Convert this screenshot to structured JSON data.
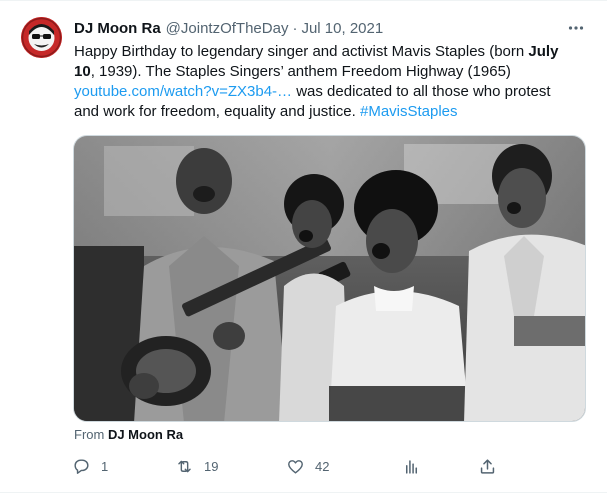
{
  "author": {
    "name": "DJ Moon Ra",
    "handle": "@JointzOfTheDay",
    "separator": "·",
    "date": "Jul 10, 2021"
  },
  "tweet": {
    "line1": "Happy Birthday to legendary singer and activist Mavis Staples (born ",
    "line1_bold": "July",
    "line2_bold": "10",
    "line2": ", 1939). The Staples Singers’ anthem Freedom Highway (1965)",
    "link": "youtube.com/watch?v=ZX3b4-…",
    "line3": " was dedicated to all those who protest",
    "line4": "and work for freedom, equality and justice. ",
    "hashtag": "#MavisStaples"
  },
  "attribution": {
    "prefix": "From ",
    "source": "DJ Moon Ra"
  },
  "actions": {
    "replies": "1",
    "retweets": "19",
    "likes": "42"
  },
  "icons": {
    "more": "more-dots-icon",
    "reply": "reply-bubble-icon",
    "retweet": "retweet-icon",
    "like": "heart-icon",
    "views": "analytics-bars-icon",
    "share": "share-upload-icon"
  },
  "colors": {
    "text": "#0f1419",
    "secondary": "#536471",
    "link": "#1d9bf0",
    "avatar_bg": "#c62828"
  }
}
